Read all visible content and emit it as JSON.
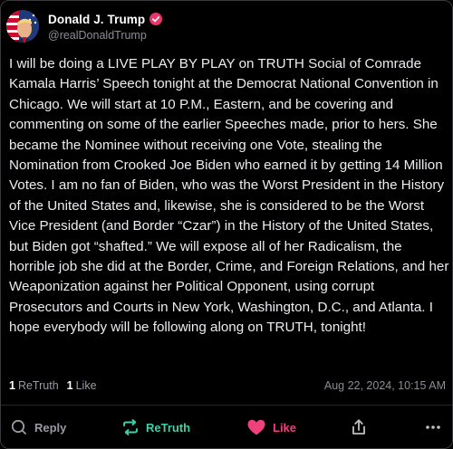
{
  "author": {
    "display_name": "Donald J. Trump",
    "handle": "@realDonaldTrump",
    "verified_color": "#e8366b"
  },
  "post": {
    "text": "I will be doing a LIVE PLAY BY PLAY on TRUTH Social of Comrade Kamala Harris’ Speech tonight at the Democrat National Convention in Chicago. We will start at 10 P.M., Eastern, and be covering and commenting on some of the earlier Speeches made, prior to hers. She became the Nominee without receiving one Vote, stealing the Nomination from Crooked Joe Biden who earned it by getting 14 Million Votes. I am no fan of Biden, who was the Worst President in the History of the United States and, likewise, she is considered to be the Worst Vice President (and Border “Czar”) in the History of the United States, but Biden got “shafted.” We will expose all of her Radicalism, the horrible job she did at the Border, Crime, and Foreign Relations, and her Weaponization against her Political Opponent, using corrupt Prosecutors and Courts in New York, Washington, D.C., and Atlanta. I hope everybody will be following along on TRUTH, tonight!"
  },
  "stats": {
    "retruth_count": "1",
    "retruth_label": "ReTruth",
    "like_count": "1",
    "like_label": "Like",
    "timestamp": "Aug 22, 2024, 10:15 AM"
  },
  "actions": {
    "reply_label": "Reply",
    "retruth_label": "ReTruth",
    "like_label": "Like"
  },
  "colors": {
    "background": "#000000",
    "retruth_accent": "#3fd0a9",
    "like_accent": "#f0417c",
    "muted_text": "#8c8c96"
  },
  "icons": [
    "reply-icon",
    "retruth-icon",
    "like-icon",
    "share-icon",
    "more-icon",
    "verified-icon"
  ]
}
